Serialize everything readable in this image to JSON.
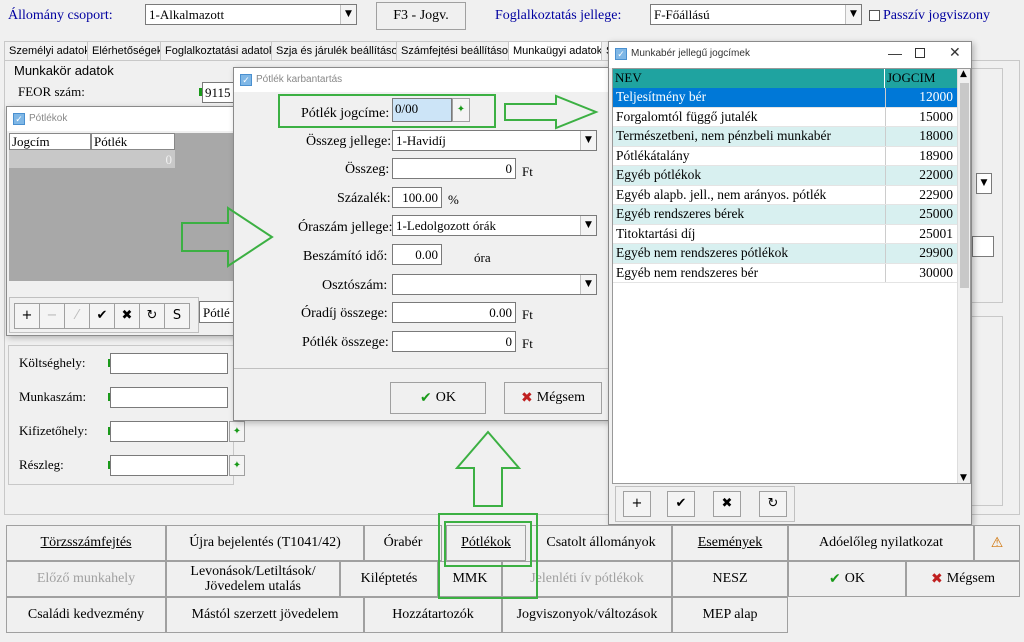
{
  "top": {
    "allomany_label": "Állomány csoport:",
    "allomany_value": "1-Alkalmazott",
    "f3_button": "F3 - Jogv.",
    "foglalkoztatas_label": "Foglalkoztatás jellege:",
    "foglalkoztatas_value": "F-Főállású",
    "passziv_label": "Passzív jogviszony"
  },
  "tabs": [
    "Személyi adatok",
    "Elérhetőségek",
    "Foglalkoztatási adatok",
    "Szja és járulék beállítások",
    "Számfejtési beállítások",
    "Munkaügyi adatok",
    "S"
  ],
  "munkakor": {
    "title": "Munkakör adatok",
    "feor_label": "FEOR szám:",
    "feor_value": "9115"
  },
  "potlekok_window": {
    "title": "Pótlékok",
    "col_jogcim": "Jogcím",
    "col_potlek": "Pótlék",
    "row_value": "0",
    "buttons": [
      "+",
      "−",
      "⁄",
      "✔",
      "✖",
      "↻",
      "S"
    ],
    "side_text": "Pótlé"
  },
  "lower_fields": [
    {
      "label": "Költséghely:"
    },
    {
      "label": "Munkaszám:"
    },
    {
      "label": "Kifizetőhely:"
    },
    {
      "label": "Részleg:"
    }
  ],
  "karbantartas": {
    "title": "Pótlék karbantartás",
    "jogcime_label": "Pótlék jogcíme:",
    "jogcime_value": "0/00",
    "osszeg_jellege_label": "Összeg jellege:",
    "osszeg_jellege_value": "1-Havidíj",
    "osszeg_label": "Összeg:",
    "osszeg_value": "0",
    "ft": "Ft",
    "szazalek_label": "Százalék:",
    "szazalek_value": "100.00",
    "percent": "%",
    "oraszam_label": "Óraszám jellege:",
    "oraszam_value": "1-Ledolgozott órák",
    "beszamito_label": "Beszámító idő:",
    "beszamito_value": "0.00",
    "ora": "óra",
    "osztoszam_label": "Osztószám:",
    "oradij_label": "Óradíj összege:",
    "oradij_value": "0.00",
    "potlek_osszege_label": "Pótlék összege:",
    "potlek_osszege_value": "0",
    "ok": "OK",
    "megsem": "Mégsem"
  },
  "jogcimek": {
    "title": "Munkabér jellegű jogcímek",
    "col_nev": "NEV",
    "col_jogcim": "JOGCIM",
    "rows": [
      {
        "nev": "Teljesítmény bér",
        "jogcim": "12000"
      },
      {
        "nev": "Forgalomtól függő jutalék",
        "jogcim": "15000"
      },
      {
        "nev": "Természetbeni, nem pénzbeli munkabér",
        "jogcim": "18000"
      },
      {
        "nev": "Pótlékátalány",
        "jogcim": "18900"
      },
      {
        "nev": "Egyéb pótlékok",
        "jogcim": "22000"
      },
      {
        "nev": "Egyéb alapb. jell., nem arányos. pótlék",
        "jogcim": "22900"
      },
      {
        "nev": "Egyéb rendszeres bérek",
        "jogcim": "25000"
      },
      {
        "nev": "Titoktartási díj",
        "jogcim": "25001"
      },
      {
        "nev": "Egyéb nem rendszeres pótlékok",
        "jogcim": "29900"
      },
      {
        "nev": "Egyéb nem rendszeres bér",
        "jogcim": "30000"
      }
    ],
    "buttons": [
      "+",
      "✔",
      "✖",
      "↻"
    ]
  },
  "bottom": {
    "row1": [
      "Törzsszámfejtés",
      "Újra bejelentés (T1041/42)",
      "Órabér",
      "Pótlékok",
      "Csatolt állományok",
      "Események",
      "Adóelőleg nyilatkozat"
    ],
    "row2": [
      "Előző munkahely",
      "Levonások/Letiltások/",
      "Jövedelem utalás",
      "Kiléptetés",
      "MMK",
      "Jelenléti ív pótlékok",
      "NESZ",
      "OK",
      "Mégsem"
    ],
    "row3": [
      "Családi kedvezmény",
      "Mástól szerzett jövedelem",
      "Hozzátartozók",
      "Jogviszonyok/változások",
      "MEP alap"
    ]
  },
  "colors": {
    "highlight": "#0078d7",
    "cyan_row": "#d8f0f0",
    "header_teal": "#1fa3a0",
    "annotation_green": "#3cb043"
  }
}
